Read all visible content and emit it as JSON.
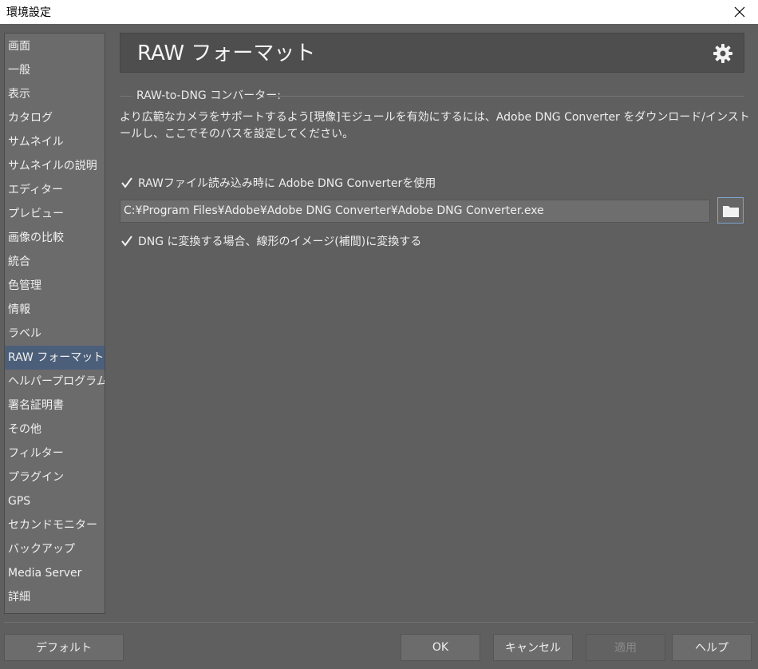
{
  "window": {
    "title": "環境設定",
    "close_icon": "close-icon"
  },
  "sidebar": {
    "items": [
      {
        "label": "画面"
      },
      {
        "label": "一般"
      },
      {
        "label": "表示"
      },
      {
        "label": "カタログ"
      },
      {
        "label": "サムネイル"
      },
      {
        "label": "サムネイルの説明"
      },
      {
        "label": "エディター"
      },
      {
        "label": "プレビュー"
      },
      {
        "label": "画像の比較"
      },
      {
        "label": "統合"
      },
      {
        "label": "色管理"
      },
      {
        "label": "情報"
      },
      {
        "label": "ラベル"
      },
      {
        "label": "RAW フォーマット"
      },
      {
        "label": "ヘルパープログラム"
      },
      {
        "label": "署名証明書"
      },
      {
        "label": "その他"
      },
      {
        "label": "フィルター"
      },
      {
        "label": "プラグイン"
      },
      {
        "label": "GPS"
      },
      {
        "label": "セカンドモニター"
      },
      {
        "label": "バックアップ"
      },
      {
        "label": "Media Server"
      },
      {
        "label": "詳細"
      }
    ],
    "selected": "RAW フォーマット"
  },
  "header": {
    "title": "RAW フォーマット",
    "settings_icon": "gear-icon"
  },
  "dng": {
    "group_label": "RAW-to-DNG コンバーター:",
    "description": "より広範なカメラをサポートするよう[現像]モジュールを有効にするには、Adobe DNG Converter をダウンロード/インストールし、ここでそのパスを設定してください。",
    "use_converter": {
      "label": "RAWファイル読み込み時に Adobe DNG Converterを使用",
      "checked": true
    },
    "converter_path": "C:¥Program Files¥Adobe¥Adobe DNG Converter¥Adobe DNG Converter.exe",
    "browse_icon": "folder-icon",
    "linear": {
      "label": "DNG に変換する場合、線形のイメージ(補間)に変換する",
      "checked": true
    }
  },
  "footer": {
    "default_label": "デフォルト",
    "ok_label": "OK",
    "cancel_label": "キャンセル",
    "apply_label": "適用",
    "apply_enabled": false,
    "help_label": "ヘルプ"
  },
  "colors": {
    "background": "#5f5f5f",
    "sidebar_selected": "#4c5f7a",
    "header_bg": "#4e4e4e",
    "browse_border": "#7ea4cf"
  }
}
